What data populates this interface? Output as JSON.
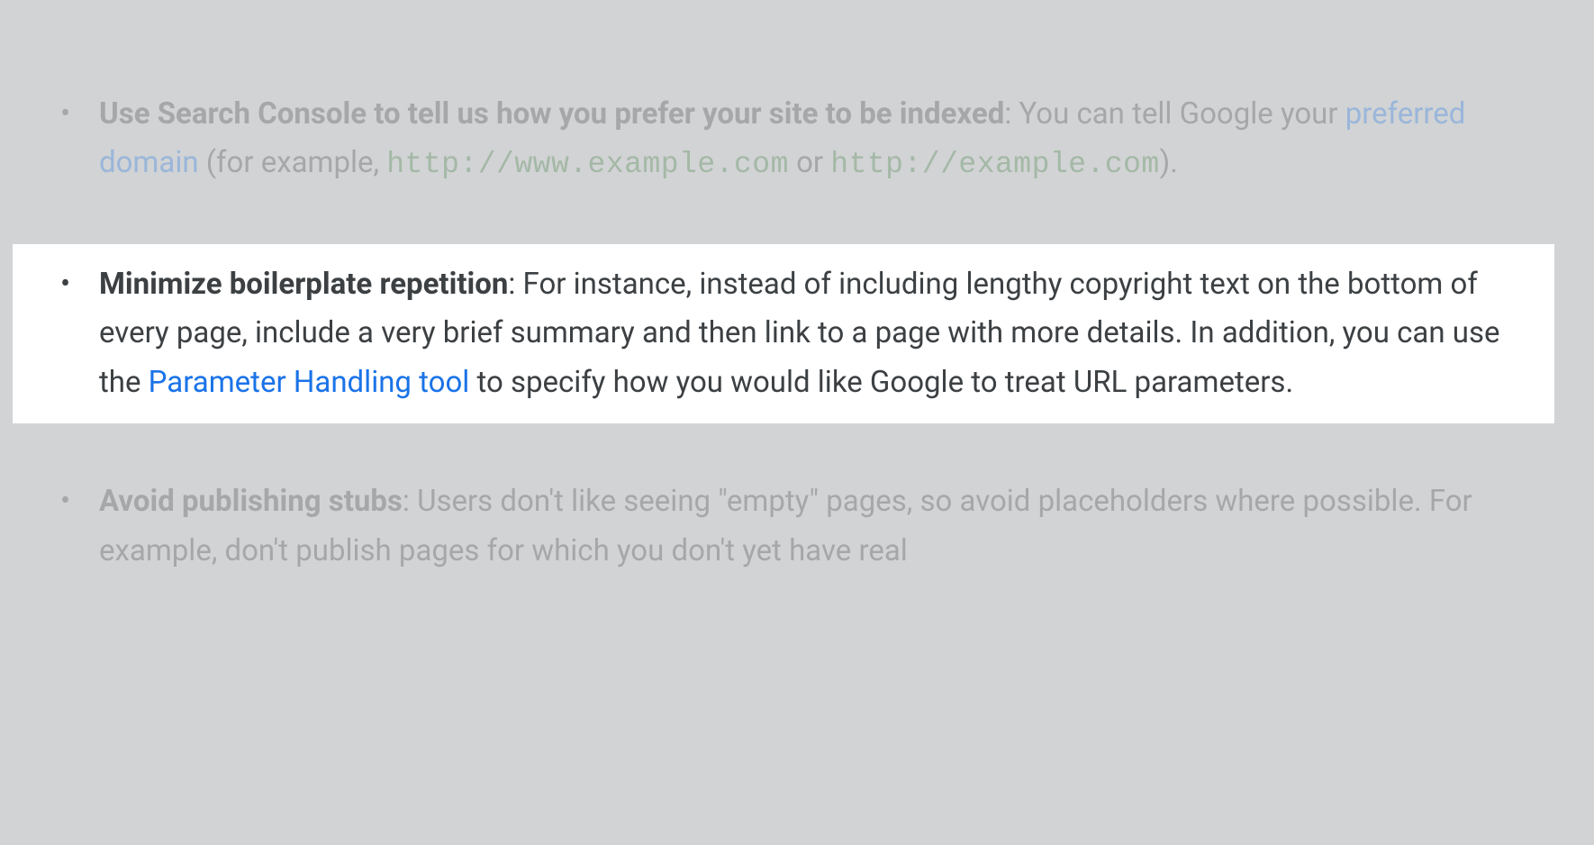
{
  "items": [
    {
      "title": "Use Search Console to tell us how you prefer your site to be indexed",
      "body_before_link": ": You can tell Google your ",
      "link_text": "preferred domain",
      "body_after_link": " (for example, ",
      "code1": "http://www.example.com",
      "between_codes": " or ",
      "code2": "http://example.com",
      "body_tail": ")."
    },
    {
      "title": "Minimize boilerplate repetition",
      "body_before_link": ": For instance, instead of including lengthy copyright text on the bottom of every page, include a very brief summary and then link to a page with more details. In addition, you can use the ",
      "link_text": "Parameter Handling tool",
      "body_after_link": " to specify how you would like Google to treat URL parameters."
    },
    {
      "title": "Avoid publishing stubs",
      "body_before_link": ": Users don't like seeing \"empty\" pages, so avoid placeholders where possible. For example, don't publish pages for which you don't yet have real"
    }
  ]
}
